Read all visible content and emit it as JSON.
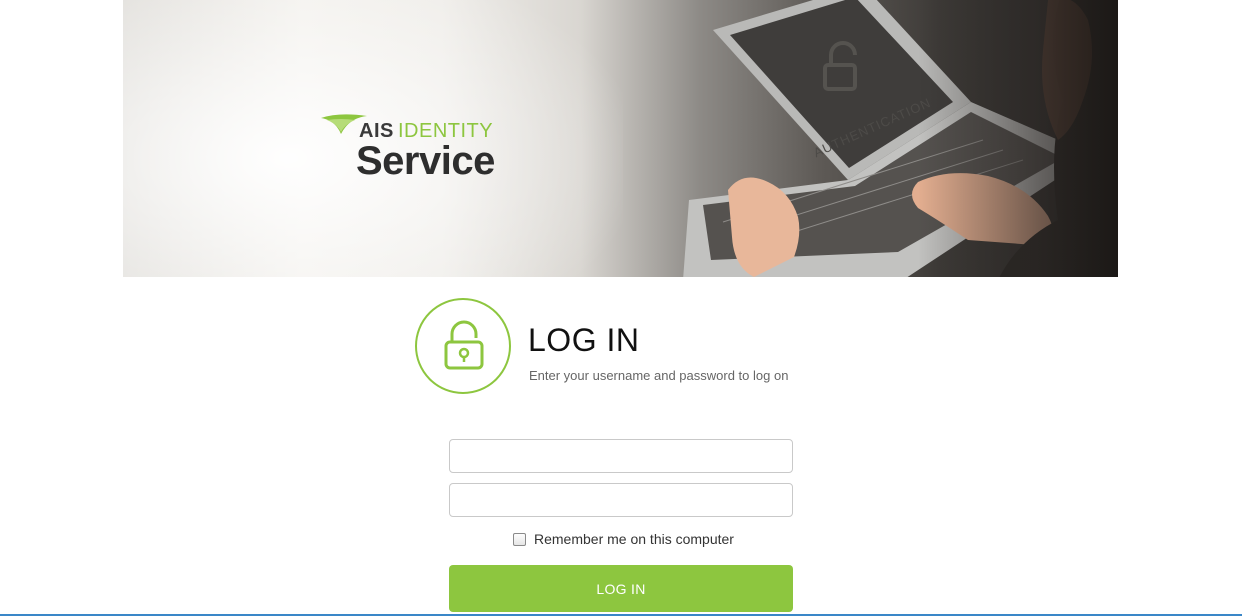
{
  "banner": {
    "logo": {
      "brand": "AIS",
      "product": "IDENTITY",
      "service": "Service"
    },
    "screen_watermark": "AUTHENTICATION"
  },
  "login": {
    "title": "LOG IN",
    "subtitle": "Enter your username and password to log on",
    "lock_icon": "unlock-icon",
    "username": {
      "value": "",
      "placeholder": ""
    },
    "password": {
      "value": "",
      "placeholder": ""
    },
    "remember_label": "Remember me on this computer",
    "remember_checked": false,
    "button_label": "LOG IN"
  },
  "colors": {
    "accent": "#8dc63f",
    "title": "#111111",
    "subtitle": "#666666",
    "bottom_bar": "#3a87c8"
  }
}
